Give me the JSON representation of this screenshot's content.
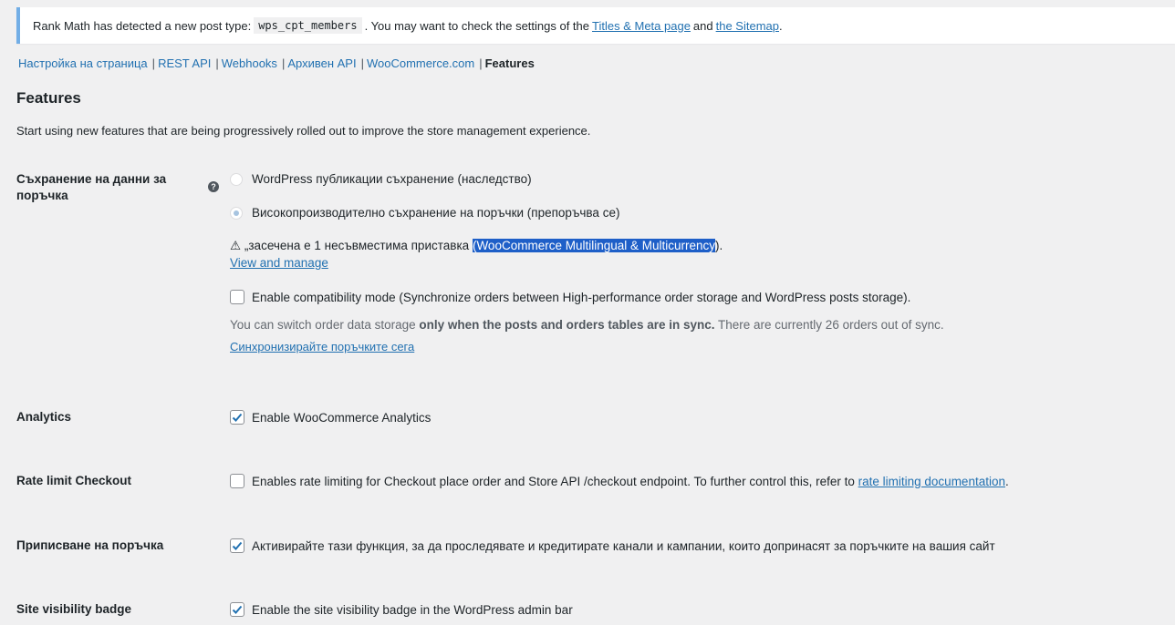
{
  "notice": {
    "text_before": "Rank Math has detected a new post type:",
    "code": "wps_cpt_members",
    "text_middle": ". You may want to check the settings of the",
    "link1": "Titles & Meta page",
    "and": "and",
    "link2": "the Sitemap",
    "end": "."
  },
  "subnav": {
    "items": [
      "Настройка на страница",
      "REST API",
      "Webhooks",
      "Архивен API",
      "WooCommerce.com"
    ],
    "current": "Features",
    "separator": "|"
  },
  "page": {
    "title": "Features",
    "description": "Start using new features that are being progressively rolled out to improve the store management experience."
  },
  "order_storage": {
    "label": "Съхранение на данни за поръчка",
    "help": "?",
    "option1": "WordPress публикации съхранение (наследство)",
    "option1_checked": false,
    "option2": "Високопроизводително съхранение на поръчки (препоръчва се)",
    "option2_checked": true,
    "warning_icon": "⚠",
    "warning_text": "„засечена е 1 несъвместима приставка",
    "warning_plugin_open": "(",
    "warning_plugin": "WooCommerce Multilingual & Multicurrency",
    "warning_plugin_close": ").",
    "view_manage": "View and manage",
    "compat_label": "Enable compatibility mode (Synchronize orders between High-performance order storage and WordPress posts storage).",
    "compat_checked": false,
    "note_before": "You can switch order data storage",
    "note_bold": "only when the posts and orders tables are in sync.",
    "note_after": "There are currently 26 orders out of sync.",
    "sync_link": "Синхронизирайте поръчките сега"
  },
  "analytics": {
    "label": "Analytics",
    "option": "Enable WooCommerce Analytics",
    "checked": true
  },
  "rate_limit": {
    "label": "Rate limit Checkout",
    "option": "Enables rate limiting for Checkout place order and Store API /checkout endpoint. To further control this, refer to",
    "link": "rate limiting documentation",
    "end": ".",
    "checked": false
  },
  "attribution": {
    "label": "Приписване на поръчка",
    "option": "Активирайте тази функция, за да проследявате и кредитирате канали и кампании, които допринасят за поръчките на вашия сайт",
    "checked": true
  },
  "site_visibility": {
    "label": "Site visibility badge",
    "option": "Enable the site visibility badge in the WordPress admin bar",
    "checked": true
  },
  "colors": {
    "link": "#2271b1",
    "notice_border": "#72aee6",
    "background": "#f0f0f1",
    "selection": "#1e5fc8"
  }
}
